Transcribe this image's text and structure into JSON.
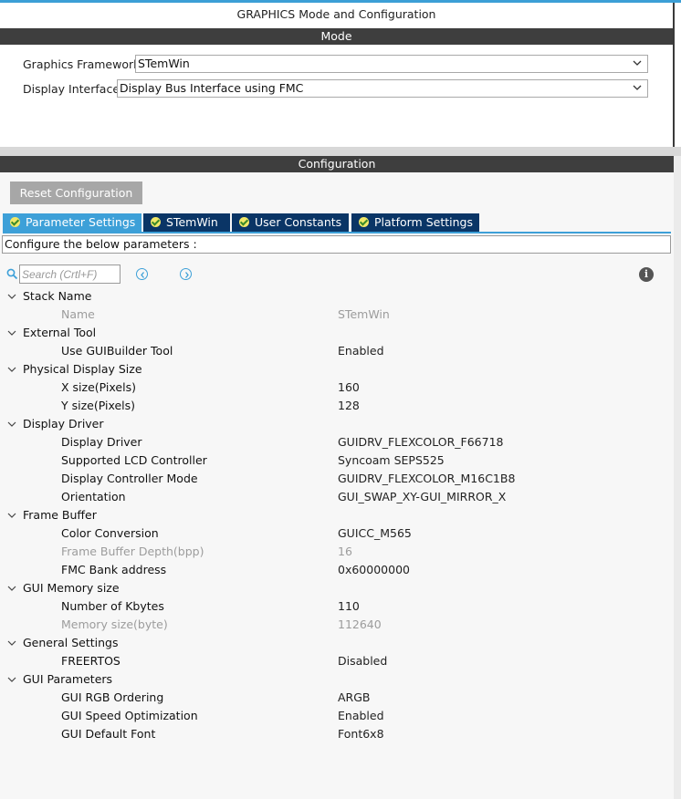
{
  "window": {
    "title": "GRAPHICS Mode and Configuration"
  },
  "mode": {
    "header": "Mode",
    "fields": [
      {
        "label": "Graphics Framework",
        "value": "STemWin"
      },
      {
        "label": "Display Interface",
        "value": "Display Bus Interface using FMC"
      }
    ]
  },
  "configuration": {
    "header": "Configuration",
    "reset_label": "Reset Configuration",
    "tabs": [
      {
        "label": "Parameter Settings",
        "active": true
      },
      {
        "label": "STemWin",
        "active": false
      },
      {
        "label": "User Constants",
        "active": false
      },
      {
        "label": "Platform Settings",
        "active": false
      }
    ],
    "hint": "Configure the below parameters :",
    "search": {
      "placeholder": "Search (Crtl+F)"
    },
    "groups": [
      {
        "name": "Stack Name",
        "params": [
          {
            "name": "Name",
            "value": "STemWin",
            "disabled": true
          }
        ]
      },
      {
        "name": "External Tool",
        "params": [
          {
            "name": "Use GUIBuilder Tool",
            "value": "Enabled",
            "disabled": false
          }
        ]
      },
      {
        "name": "Physical Display Size",
        "params": [
          {
            "name": "X size(Pixels)",
            "value": "160",
            "disabled": false
          },
          {
            "name": "Y size(Pixels)",
            "value": "128",
            "disabled": false
          }
        ]
      },
      {
        "name": "Display Driver",
        "params": [
          {
            "name": "Display Driver",
            "value": "GUIDRV_FLEXCOLOR_F66718",
            "disabled": false
          },
          {
            "name": "Supported LCD Controller",
            "value": "Syncoam SEPS525",
            "disabled": false
          },
          {
            "name": "Display Controller Mode",
            "value": "GUIDRV_FLEXCOLOR_M16C1B8",
            "disabled": false
          },
          {
            "name": "Orientation",
            "value": "GUI_SWAP_XY-GUI_MIRROR_X",
            "disabled": false
          }
        ]
      },
      {
        "name": "Frame Buffer",
        "params": [
          {
            "name": "Color Conversion",
            "value": "GUICC_M565",
            "disabled": false
          },
          {
            "name": "Frame Buffer Depth(bpp)",
            "value": "16",
            "disabled": true
          },
          {
            "name": "FMC Bank address",
            "value": "0x60000000",
            "disabled": false
          }
        ]
      },
      {
        "name": "GUI Memory size",
        "params": [
          {
            "name": "Number of Kbytes",
            "value": "110",
            "disabled": false
          },
          {
            "name": "Memory size(byte)",
            "value": "112640",
            "disabled": true
          }
        ]
      },
      {
        "name": "General Settings",
        "params": [
          {
            "name": "FREERTOS",
            "value": "Disabled",
            "disabled": false
          }
        ]
      },
      {
        "name": "GUI Parameters",
        "params": [
          {
            "name": "GUI RGB Ordering",
            "value": "ARGB",
            "disabled": false
          },
          {
            "name": "GUI Speed Optimization",
            "value": "Enabled",
            "disabled": false
          },
          {
            "name": "GUI Default Font",
            "value": "Font6x8",
            "disabled": false
          }
        ]
      }
    ]
  },
  "colors": {
    "accent": "#3da0d8",
    "header_bar": "#3e3e3e",
    "tab_inactive": "#0a3566",
    "disabled_text": "#9c9c9c"
  }
}
